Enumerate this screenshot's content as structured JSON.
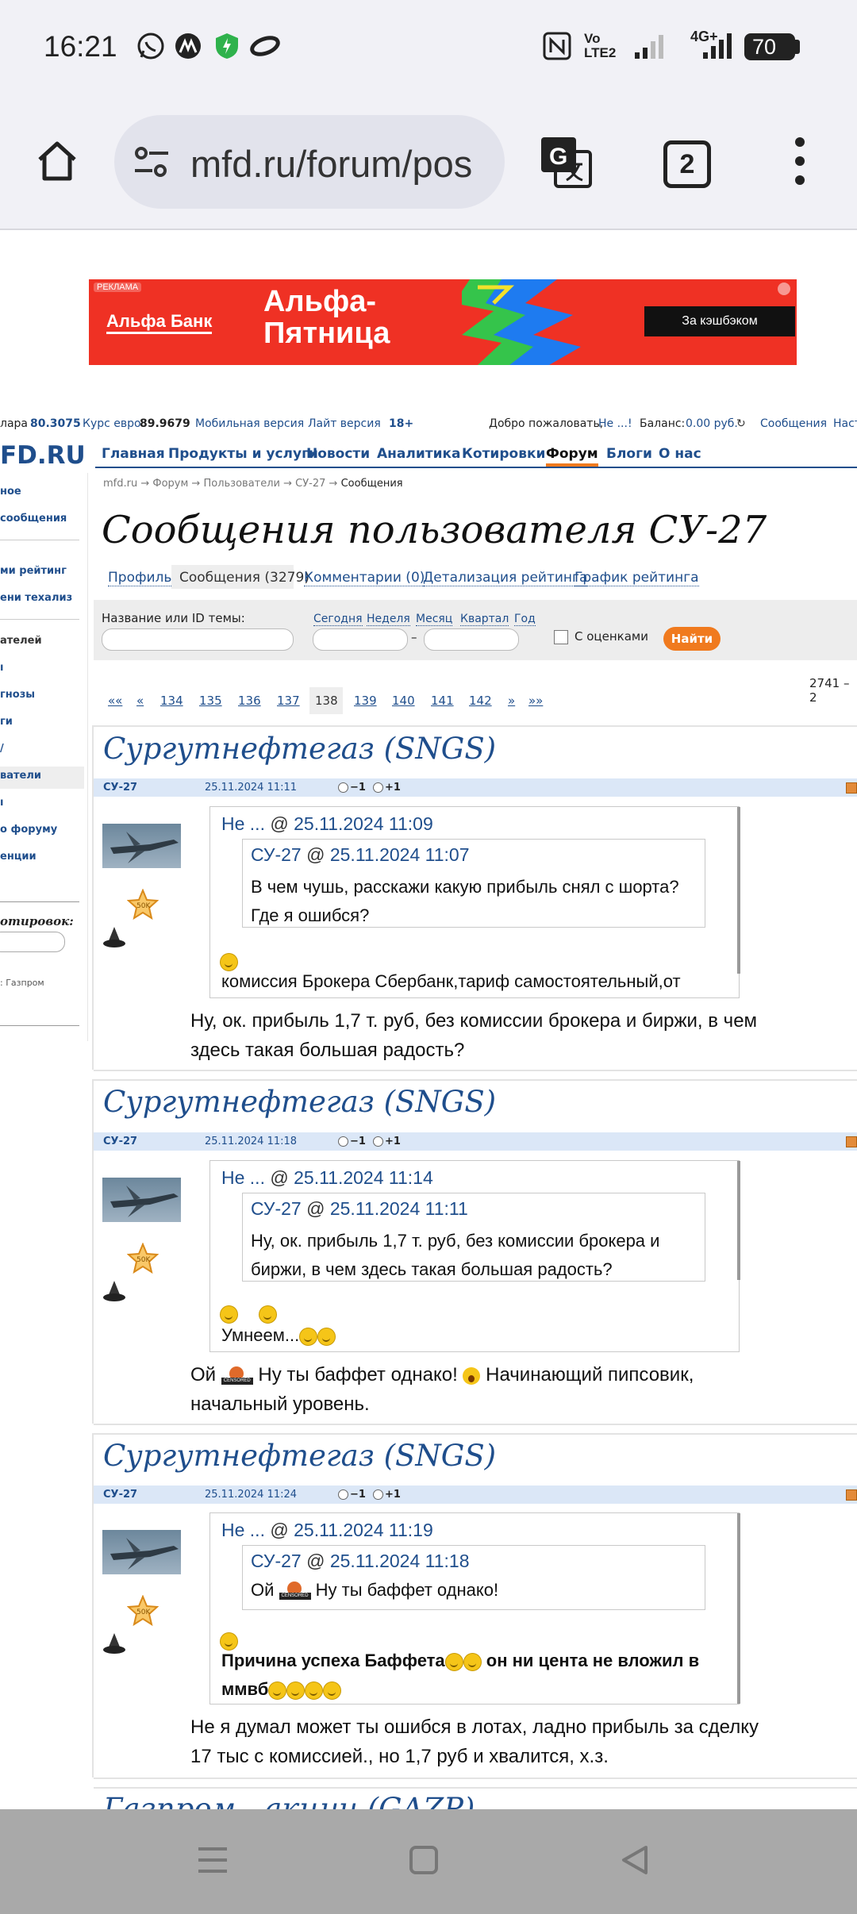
{
  "status_bar": {
    "time": "16:21",
    "battery": "70",
    "network_label": "4G+",
    "volte": "Vo LTE2"
  },
  "browser": {
    "url": "mfd.ru/forum/pos",
    "tab_count": "2"
  },
  "ad": {
    "label": "РЕКЛАМА",
    "brand": "Альфа Банк",
    "headline": "Альфа-Пятница",
    "button": "За кэшбэком"
  },
  "site": {
    "top_strip": {
      "usd_label": "лара",
      "usd_value": "80.3075",
      "eur_label": "Курс евро",
      "eur_value": "89.9679",
      "mobile_version": "Мобильная версия",
      "lite_version": "Лайт версия",
      "age": "18+",
      "welcome_prefix": "Добро пожаловать,",
      "welcome_user": "Не ...!",
      "balance_label": "Баланс:",
      "balance_value": "0.00 руб.",
      "messages": "Сообщения",
      "settings": "Наст"
    },
    "logo": "FD.RU",
    "nav": [
      "Главная",
      "Продукты и услуги",
      "Новости",
      "Аналитика",
      "Котировки",
      "Форум",
      "Блоги",
      "О нас"
    ],
    "nav_active": "Форум",
    "breadcrumb": [
      "mfd.ru",
      "Форум",
      "Пользователи",
      "СУ-27",
      "Сообщения"
    ],
    "page_title": "Сообщения пользователя СУ-27",
    "tabs": [
      "Профиль",
      "Сообщения (3279)",
      "Комментарии (0)",
      "Детализация рейтинга",
      "График рейтинга"
    ],
    "sidebar": [
      "ное",
      "сообщения",
      "ми рейтинг",
      "ени техализ",
      "ателей",
      "",
      "гнозы",
      "ги",
      "",
      "ватели",
      "",
      "о форуму",
      "енции"
    ],
    "sidebar_quote_label": "отировок:",
    "sidebar_quote_hint": ": Газпром",
    "filter": {
      "topic_label": "Название или ID темы:",
      "today": "Сегодня",
      "week": "Неделя",
      "month": "Месяц",
      "quarter": "Квартал",
      "year": "Год",
      "dash": "–",
      "with_ratings": "С оценками",
      "find_button": "Найти"
    },
    "range": "2741 – 2",
    "pagination": [
      "««",
      "«",
      "134",
      "135",
      "136",
      "137",
      "138",
      "139",
      "140",
      "141",
      "142",
      "»",
      "»»"
    ],
    "current_page": "138",
    "posts": [
      {
        "topic": "Сургутнефтегаз (SNGS)",
        "author": "СУ-27",
        "date": "25.11.2024 11:11",
        "minus": "−1",
        "plus": "+1",
        "badge": "50K",
        "quote_author": "Не ...",
        "quote_date": "25.11.2024 11:09",
        "inner_author": "СУ-27",
        "inner_date": "25.11.2024 11:07",
        "inner_text": "В чем чушь, расскажи какую прибыль снял с шорта? Где я ошибся?",
        "quote_text": "комиссия Брокера Сбербанк,тариф самостоятельный,от",
        "body": "Ну, ок. прибыль 1,7 т. руб, без комиссии брокера и биржи, в чем здесь такая большая радость?"
      },
      {
        "topic": "Сургутнефтегаз (SNGS)",
        "author": "СУ-27",
        "date": "25.11.2024 11:18",
        "minus": "−1",
        "plus": "+1",
        "badge": "50K",
        "quote_author": "Не ...",
        "quote_date": "25.11.2024 11:14",
        "inner_author": "СУ-27",
        "inner_date": "25.11.2024 11:11",
        "inner_text": "Ну, ок. прибыль 1,7 т. руб, без комиссии брокера и биржи, в чем здесь такая большая радость?",
        "quote_text": "Умнеем...",
        "body_a": "Ой",
        "body_b": "Ну ты баффет однако!",
        "body_c": "Начинающий пипсовик, начальный уровень."
      },
      {
        "topic": "Сургутнефтегаз (SNGS)",
        "author": "СУ-27",
        "date": "25.11.2024 11:24",
        "minus": "−1",
        "plus": "+1",
        "badge": "50K",
        "quote_author": "Не ...",
        "quote_date": "25.11.2024 11:19",
        "inner_author": "СУ-27",
        "inner_date": "25.11.2024 11:18",
        "inner_text_a": "Ой",
        "inner_text_b": "Ну ты баффет однако!",
        "quote_text_a": "Причина успеха Баффета",
        "quote_text_b": "он ни цента не вложил в ммвб",
        "body": "Не я думал может ты ошибся в лотах, ладно прибыль за сделку 17 тыс с комиссией., но 1,7 руб и хвалится, х.з."
      }
    ],
    "next_topic": "Газпром - акции (GAZP)"
  },
  "colors": {
    "link": "#1f4e8c",
    "ad_red": "#ef3124",
    "find_button": "#f07a1e",
    "post_bar": "#dbe7f7",
    "nav_active_underline": "#f07a1e"
  },
  "icons": [
    "home-icon",
    "tune-icon",
    "translate-icon",
    "tabs-icon",
    "menu-dots-icon",
    "whatsapp-icon",
    "vpn-icon",
    "recents-icon",
    "home-nav-icon",
    "back-nav-icon"
  ]
}
